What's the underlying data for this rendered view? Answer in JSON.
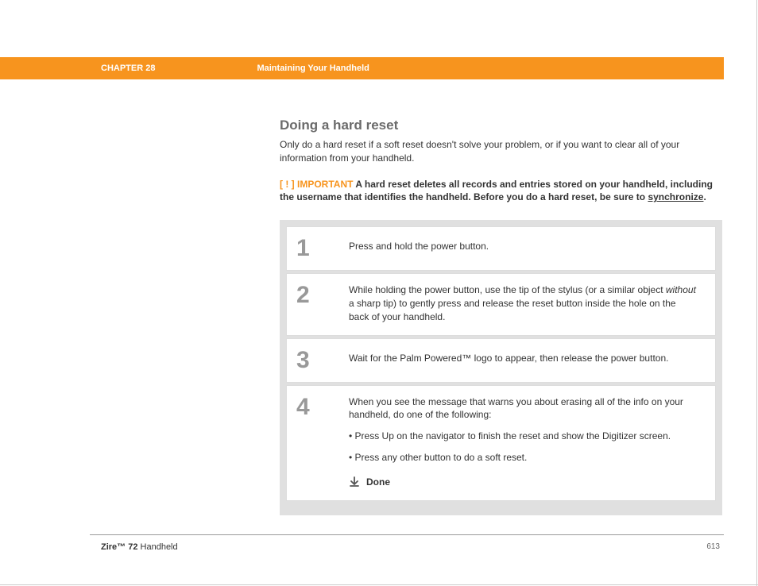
{
  "header": {
    "chapter": "CHAPTER 28",
    "title": "Maintaining Your Handheld"
  },
  "section": {
    "heading": "Doing a hard reset",
    "intro": "Only do a hard reset if a soft reset doesn't solve your problem, or if you want to clear all of your information from your handheld.",
    "important_marker": "[ ! ]",
    "important_label": "IMPORTANT",
    "important_text_before": "A hard reset deletes all records and entries stored on your handheld, including the username that identifies the handheld. Before you do a hard reset, be sure to ",
    "important_link": "synchronize",
    "important_text_after": "."
  },
  "steps": [
    {
      "num": "1",
      "text": "Press and hold the power button."
    },
    {
      "num": "2",
      "text_before": "While holding the power button, use the tip of the stylus (or a similar object ",
      "italic": "without",
      "text_after": " a sharp tip) to gently press and release the reset button inside the hole on the back of your handheld."
    },
    {
      "num": "3",
      "text": "Wait for the Palm Powered™  logo to appear, then release the power button."
    },
    {
      "num": "4",
      "text": "When you see the message that warns you about erasing all of the info on your handheld, do one of the following:",
      "bullets": [
        "Press Up on the navigator to finish the reset and show the Digitizer screen.",
        "Press any other button to do a soft reset."
      ],
      "done": "Done"
    }
  ],
  "footer": {
    "product_bold": "Zire™ 72",
    "product_rest": " Handheld",
    "page": "613"
  }
}
